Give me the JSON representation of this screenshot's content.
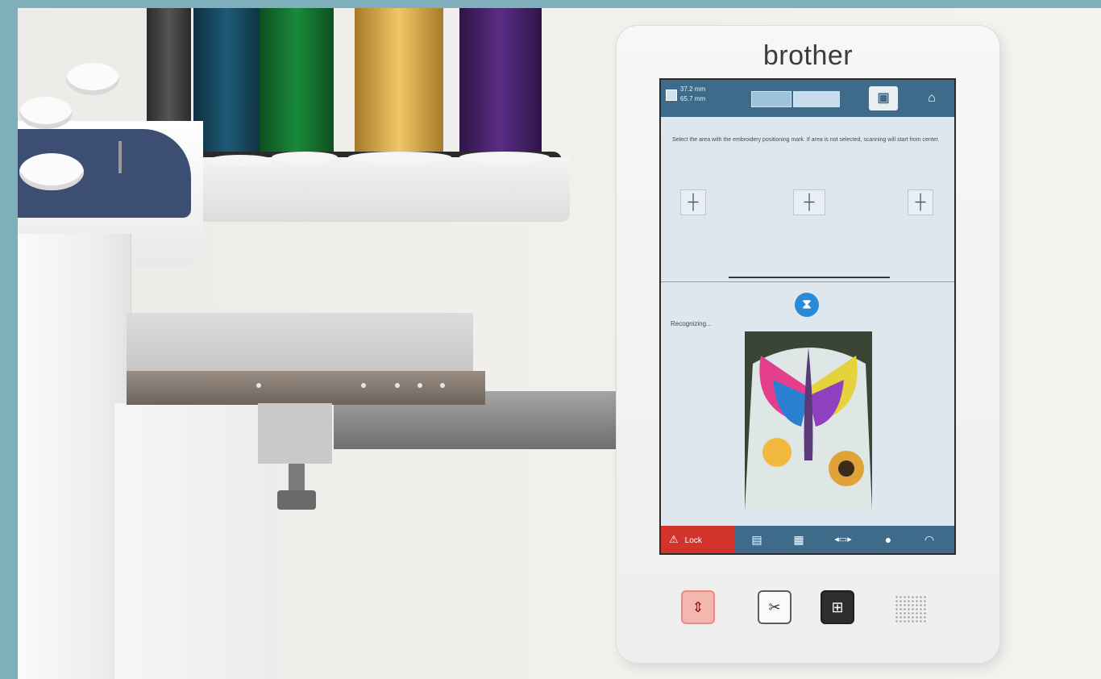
{
  "brand": {
    "name": "brother"
  },
  "screen": {
    "topbar": {
      "dim_top": "37.2 mm",
      "dim_bottom": "65.7 mm",
      "camera_icon": "camera-icon",
      "home_icon": "home-icon"
    },
    "instruction": "Select the area with the embroidery positioning mark. If area is not selected, scanning will start from center.",
    "mark_buttons": [
      {
        "label": "┼",
        "icon": "mark-left-icon"
      },
      {
        "label": "┼",
        "icon": "mark-center-icon"
      },
      {
        "label": "┼",
        "icon": "mark-right-icon"
      }
    ],
    "status": "Recognizing...",
    "bottombar": {
      "lock_label": "Lock",
      "icons": [
        "document-icon",
        "thread-icon",
        "frame-icon",
        "spool-icon",
        "wifi-icon"
      ]
    },
    "colors": {
      "bar": "#3f6b8b",
      "lock": "#d2342b",
      "spinner": "#2a8ad6"
    }
  },
  "hardware_buttons": [
    {
      "name": "start-stop-button",
      "glyph": "⇕"
    },
    {
      "name": "thread-cutter-button",
      "glyph": "✂"
    },
    {
      "name": "frame-move-button",
      "glyph": "⊞"
    }
  ]
}
